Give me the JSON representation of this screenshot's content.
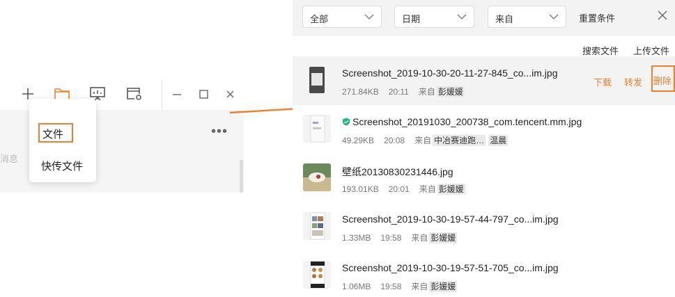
{
  "toolbar": {
    "icons": [
      "plus-icon",
      "folder-icon",
      "presentation-icon",
      "card-settings-icon",
      "minimize-icon",
      "maximize-icon",
      "close-icon"
    ],
    "accent": "#f07f2d"
  },
  "left_panel": {
    "truncated_text": "消息",
    "more": "•••"
  },
  "dropdown": {
    "items": [
      "文件",
      "快传文件"
    ]
  },
  "filters": {
    "all": "全部",
    "date": "日期",
    "from": "来自",
    "reset": "重置条件"
  },
  "actions": {
    "search_files": "搜索文件",
    "upload_files": "上传文件",
    "download": "下载",
    "forward": "转发",
    "delete": "删除"
  },
  "files": [
    {
      "name": "Screenshot_2019-10-30-20-11-27-845_co...im.jpg",
      "size": "271.84KB",
      "time": "20:11",
      "from_label": "来自",
      "sender": "彭媛媛",
      "verified": false,
      "selected": true
    },
    {
      "name": "Screenshot_20191030_200738_com.tencent.mm.jpg",
      "size": "49.29KB",
      "time": "20:08",
      "from_label": "来自",
      "sender": "中冶赛迪跑…",
      "sender2": "温晨",
      "verified": true,
      "selected": false
    },
    {
      "name": "壁纸20130830231446.jpg",
      "size": "193.01KB",
      "time": "20:01",
      "from_label": "来自",
      "sender": "彭媛媛",
      "verified": false,
      "selected": false
    },
    {
      "name": "Screenshot_2019-10-30-19-57-44-797_co...im.jpg",
      "size": "1.33MB",
      "time": "19:58",
      "from_label": "来自",
      "sender": "彭媛媛",
      "verified": false,
      "selected": false
    },
    {
      "name": "Screenshot_2019-10-30-19-57-51-705_co...im.jpg",
      "size": "1.06MB",
      "time": "19:58",
      "from_label": "来自",
      "sender": "彭媛媛",
      "verified": false,
      "selected": false
    }
  ]
}
